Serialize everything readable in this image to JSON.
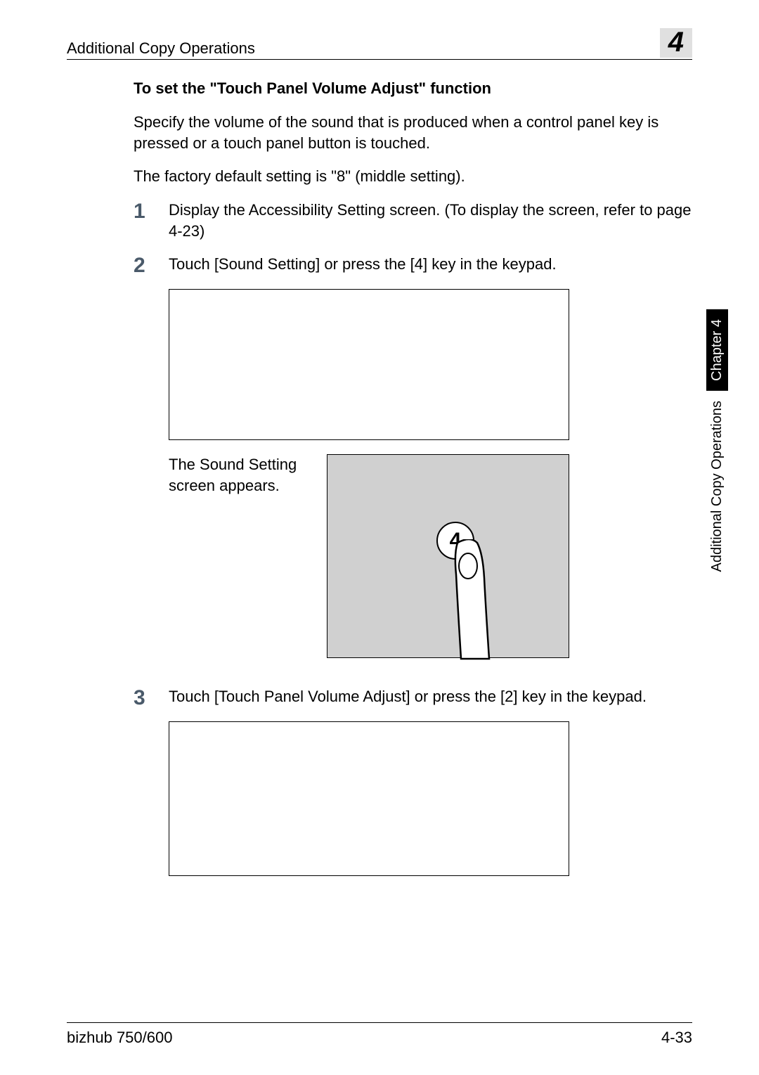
{
  "header": {
    "title": "Additional Copy Operations",
    "chapter_num": "4"
  },
  "section": {
    "heading": "To set the \"Touch Panel Volume Adjust\" function",
    "intro1": "Specify the volume of the sound that is produced when a control panel key is pressed or a touch panel button is touched.",
    "intro2": " The factory default setting is \"8\" (middle setting)."
  },
  "steps": {
    "s1": {
      "num": "1",
      "text": "Display the Accessibility Setting screen. (To display the screen, refer to page 4-23)"
    },
    "s2": {
      "num": "2",
      "text": "Touch [Sound Setting] or press the [4] key in the keypad."
    },
    "sound_result": "The Sound Setting screen appears.",
    "touch_key": "4",
    "s3": {
      "num": "3",
      "text": "Touch [Touch Panel Volume Adjust] or press the [2] key in the keypad."
    }
  },
  "sidetab": {
    "black": "Chapter 4",
    "white": "Additional Copy Operations"
  },
  "footer": {
    "left": "bizhub 750/600",
    "right": "4-33"
  }
}
